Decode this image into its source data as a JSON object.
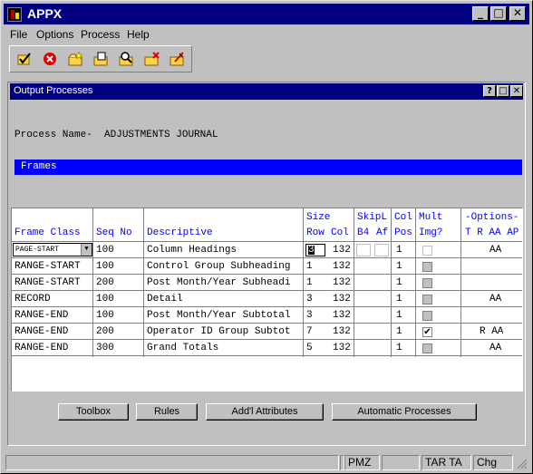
{
  "window": {
    "title": "APPX",
    "controls": [
      "_",
      "□",
      "✕"
    ]
  },
  "menu": [
    "File",
    "Options",
    "Process",
    "Help"
  ],
  "toolbar": [
    "ok-check-icon",
    "cancel-icon",
    "new-folder-icon",
    "open-folder-icon",
    "find-folder-icon",
    "delete-folder-icon",
    "edit-folder-icon"
  ],
  "dialog": {
    "title": "Output Processes",
    "controls": [
      "?",
      "□",
      "✕"
    ],
    "process_label": "Process Name-",
    "process_name": "ADJUSTMENTS JOURNAL",
    "section": "Frames"
  },
  "headers": {
    "frame_class": "Frame Class",
    "seq_no": "Seq No",
    "descriptive": "Descriptive",
    "size": "Size",
    "row": "Row",
    "col": "Col",
    "skipl": "SkipL",
    "b4": "B4",
    "af": "Af",
    "col2": "Col",
    "pos": "Pos",
    "mult": "Mult",
    "img": "Img?",
    "options": "-Options-",
    "options_sub": "T R AA AP"
  },
  "rows": [
    {
      "frame_class": "PAGE-START",
      "seq": "100",
      "desc": "Column Headings",
      "row": "3",
      "col": "132",
      "pos": "1",
      "mult": "none",
      "options": "AA"
    },
    {
      "frame_class": "RANGE-START",
      "seq": "100",
      "desc": "Control Group Subheading",
      "row": "1",
      "col": "132",
      "pos": "1",
      "mult": "unchecked",
      "options": ""
    },
    {
      "frame_class": "RANGE-START",
      "seq": "200",
      "desc": "Post Month/Year Subheadi",
      "row": "1",
      "col": "132",
      "pos": "1",
      "mult": "unchecked",
      "options": ""
    },
    {
      "frame_class": "RECORD",
      "seq": "100",
      "desc": "Detail",
      "row": "3",
      "col": "132",
      "pos": "1",
      "mult": "unchecked",
      "options": "AA"
    },
    {
      "frame_class": "RANGE-END",
      "seq": "100",
      "desc": "Post Month/Year Subtotal",
      "row": "3",
      "col": "132",
      "pos": "1",
      "mult": "unchecked",
      "options": ""
    },
    {
      "frame_class": "RANGE-END",
      "seq": "200",
      "desc": "Operator ID Group Subtot",
      "row": "7",
      "col": "132",
      "pos": "1",
      "mult": "checked",
      "options": "R AA"
    },
    {
      "frame_class": "RANGE-END",
      "seq": "300",
      "desc": "Grand Totals",
      "row": "5",
      "col": "132",
      "pos": "1",
      "mult": "unchecked",
      "options": "AA"
    }
  ],
  "buttons": [
    "Toolbox",
    "Rules",
    "Add'l Attributes",
    "Automatic Processes"
  ],
  "status": [
    "",
    "",
    "PMZ",
    "",
    "TAR TA",
    "Chg"
  ]
}
